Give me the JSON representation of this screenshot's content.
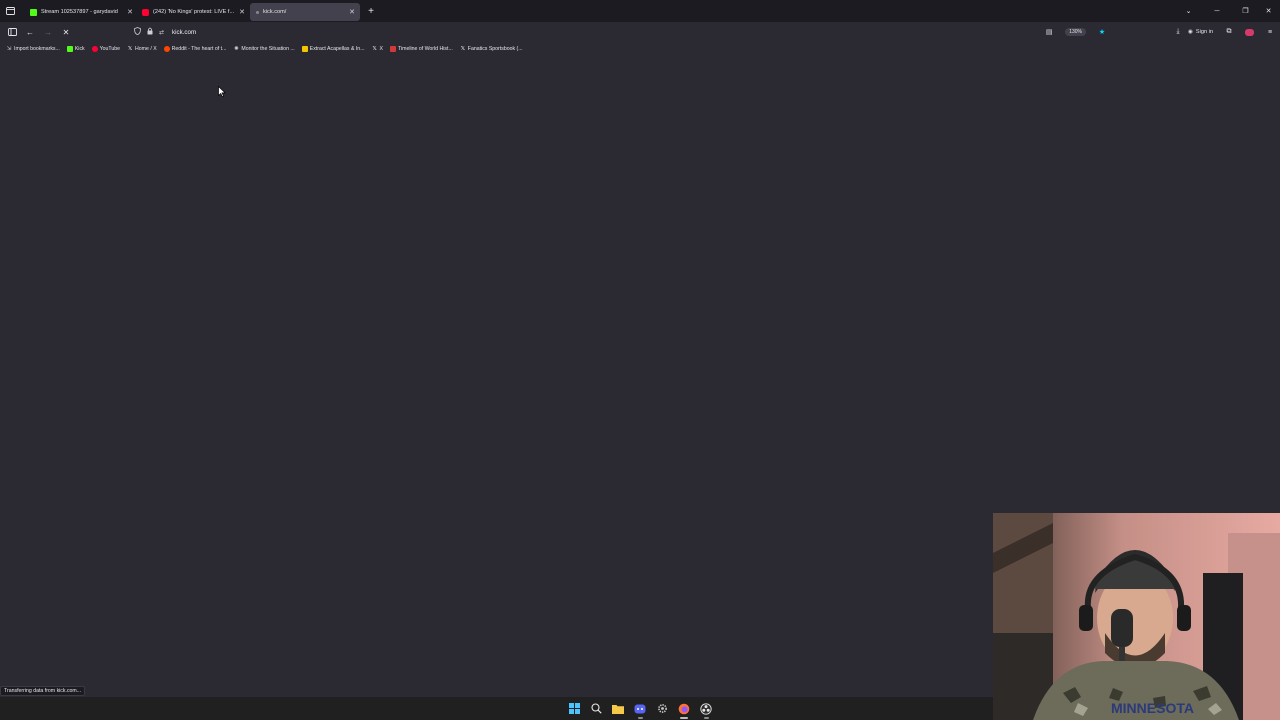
{
  "tabs": [
    {
      "title": "Stream 102537897 - garydavid",
      "favicon_color": "#53fc18",
      "active": false
    },
    {
      "title": "(242) 'No Kings' protest: LIVE f...",
      "favicon_color": "#ff0033",
      "active": false
    },
    {
      "title": "kick.com/",
      "favicon_color": "#888888",
      "active": true
    }
  ],
  "url": "kick.com",
  "zoom": "130%",
  "signin_label": "Sign in",
  "bookmarks": [
    {
      "label": "Import bookmarks...",
      "icon": "import-icon"
    },
    {
      "label": "Kick",
      "icon": "kick-icon",
      "color": "#53fc18"
    },
    {
      "label": "YouTube",
      "icon": "youtube-icon",
      "color": "#ff0033"
    },
    {
      "label": "Home / X",
      "icon": "x-icon"
    },
    {
      "label": "Reddit - The heart of t...",
      "icon": "reddit-icon",
      "color": "#ff4500"
    },
    {
      "label": "Monitor the Situation ...",
      "icon": "monitor-icon"
    },
    {
      "label": "Extract Acapellas & In...",
      "icon": "lalal-icon",
      "color": "#f5c400"
    },
    {
      "label": "X",
      "icon": "x-icon"
    },
    {
      "label": "Timeline of World Hist...",
      "icon": "timeline-icon",
      "color": "#d23a3a"
    },
    {
      "label": "Fanatics Sportsbook (...",
      "icon": "x-icon"
    }
  ],
  "status_text": "Transferring data from kick.com...",
  "colors": {
    "chrome": "#1c1b22",
    "toolbar": "#2b2a33",
    "accent": "#00ddff"
  }
}
